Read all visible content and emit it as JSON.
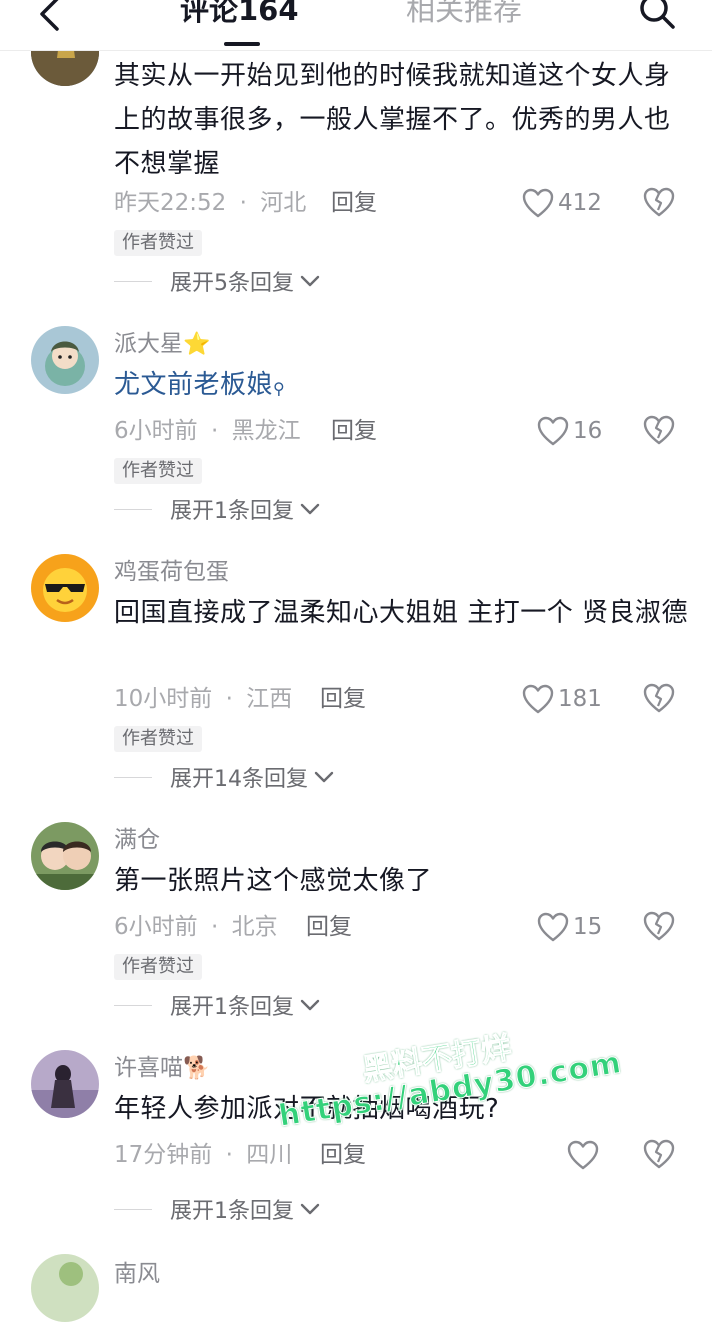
{
  "header": {
    "back_icon": "chevron-left-icon",
    "tabs": [
      {
        "label": "评论164",
        "active": true
      },
      {
        "label": "相关推荐",
        "active": false
      }
    ],
    "search_icon": "search-icon"
  },
  "comments": [
    {
      "name": "",
      "text": "其实从一开始见到他的时候我就知道这个女人身上的故事很多，一般人掌握不了。优秀的男人也不想掌握",
      "time": "昨天22:52",
      "location": "河北",
      "reply_label": "回复",
      "likes": "412",
      "badge": "作者赞过",
      "expand": "展开5条回复"
    },
    {
      "name": "派大星",
      "name_emoji": "⭐",
      "text": "尤文前老板娘",
      "text_is_search_link": true,
      "time": "6小时前",
      "location": "黑龙江",
      "reply_label": "回复",
      "likes": "16",
      "badge": "作者赞过",
      "expand": "展开1条回复"
    },
    {
      "name": "鸡蛋荷包蛋",
      "text": "回国直接成了温柔知心大姐姐 主打一个 贤良淑德",
      "time": "10小时前",
      "location": "江西",
      "reply_label": "回复",
      "likes": "181",
      "badge": "作者赞过",
      "expand": "展开14条回复"
    },
    {
      "name": "满仓",
      "text": "第一张照片这个感觉太像了",
      "time": "6小时前",
      "location": "北京",
      "reply_label": "回复",
      "likes": "15",
      "badge": "作者赞过",
      "expand": "展开1条回复"
    },
    {
      "name": "许喜喵",
      "name_emoji": "🐕",
      "text": "年轻人参加派对不就抽烟喝酒玩?",
      "time": "17分钟前",
      "location": "四川",
      "reply_label": "回复",
      "likes": "",
      "expand": "展开1条回复"
    },
    {
      "name": "南风"
    }
  ],
  "separator": "·",
  "watermark": {
    "line1": "黑料不打烊",
    "line2": "https://abdy30.com"
  },
  "colors": {
    "text": "#161823",
    "secondary": "#a8a9ad",
    "link": "#2b5a94",
    "watermark": "#33d17a"
  }
}
